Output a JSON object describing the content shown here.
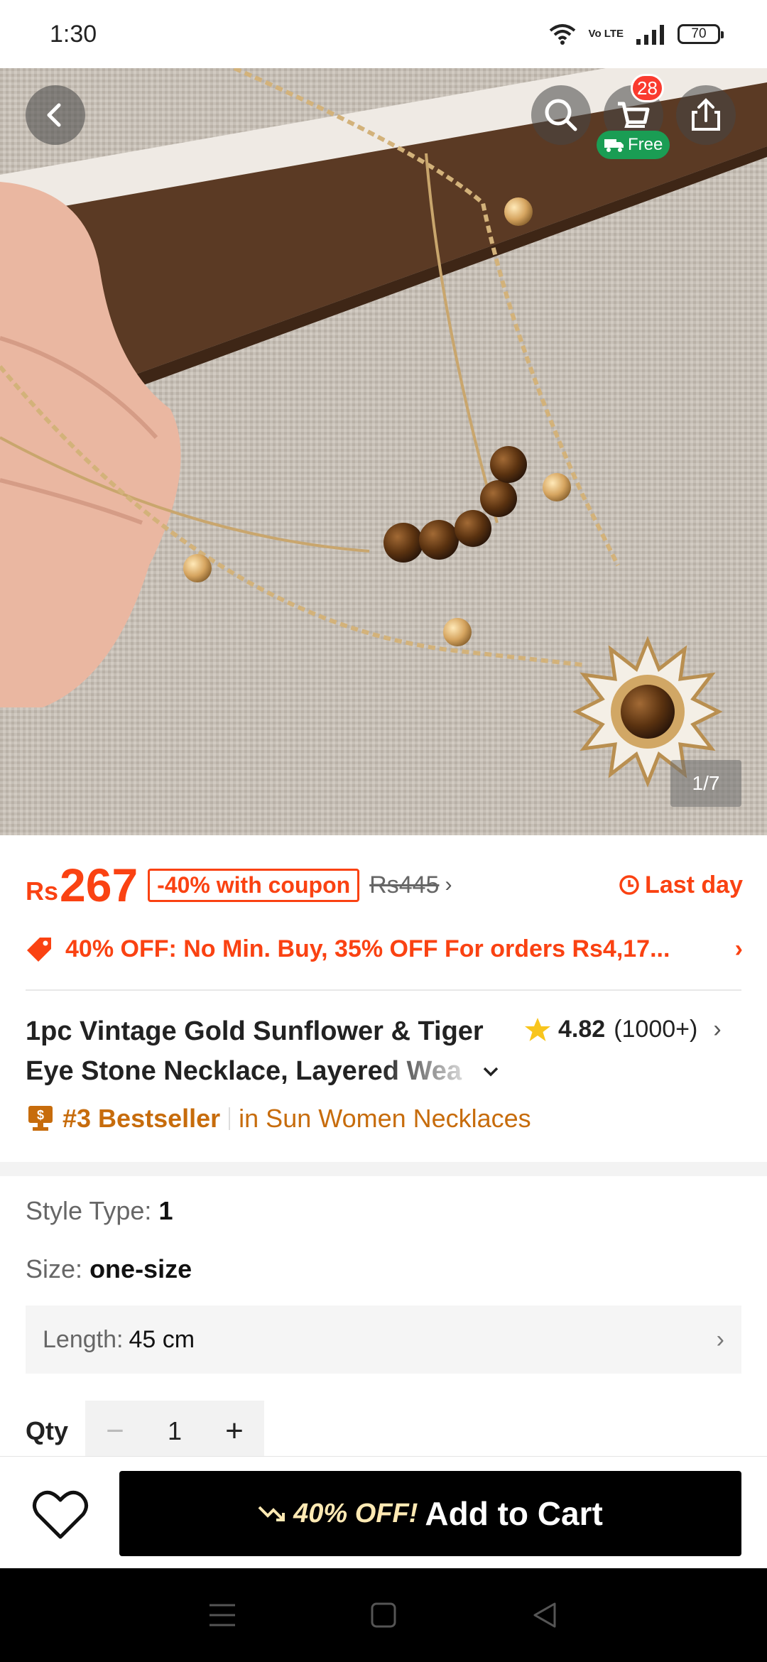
{
  "status_bar": {
    "time": "1:30",
    "battery": "70",
    "network_label": "Vo LTE"
  },
  "gallery": {
    "page_indicator": "1/7",
    "cart_count": "28",
    "free_shipping_label": "Free"
  },
  "price": {
    "currency": "Rs",
    "current": "267",
    "coupon": "-40% with coupon",
    "original": "Rs445",
    "deadline": "Last day"
  },
  "promo": {
    "text": "40% OFF: No Min. Buy,  35% OFF For orders Rs4,17..."
  },
  "product": {
    "title_line1": "1pc Vintage Gold Sunflower & Tiger",
    "title_line2": "Eye Stone Necklace, Layered Wea",
    "rating": "4.82",
    "rating_count": "(1000+)",
    "bestseller_rank": "#3 Bestseller",
    "bestseller_category": "in Sun Women Necklaces"
  },
  "attributes": {
    "style_label": "Style Type:",
    "style_value": "1",
    "size_label": "Size:",
    "size_value": "one-size",
    "length_label": "Length:",
    "length_value": "45 cm"
  },
  "quantity": {
    "label": "Qty",
    "value": "1"
  },
  "bottom": {
    "discount": "40% OFF!",
    "add_to_cart": "Add to Cart"
  },
  "colors": {
    "accent": "#fa4212",
    "bestseller": "#c76c0c",
    "free_badge": "#1a9d54",
    "cart_badge": "#fa3b2f"
  }
}
